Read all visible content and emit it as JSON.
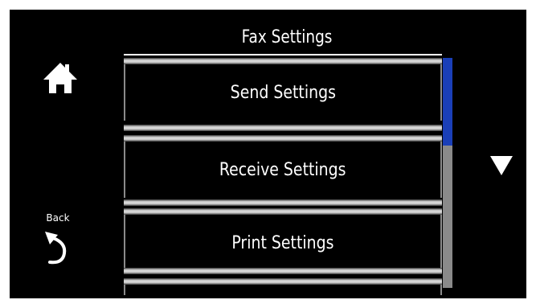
{
  "header": {
    "title": "Fax Settings"
  },
  "nav": {
    "back_label": "Back"
  },
  "menu": {
    "items": [
      {
        "label": "Send Settings"
      },
      {
        "label": "Receive Settings"
      },
      {
        "label": "Print Settings"
      }
    ]
  },
  "scroll": {
    "position_fraction": 0.0,
    "visible_fraction": 0.38
  },
  "colors": {
    "background": "#000000",
    "text": "#ffffff",
    "scrollbar_thumb": "#1a3fb8",
    "scrollbar_track": "#8a8a8a"
  },
  "icons": {
    "home": "home-icon",
    "back": "back-arrow-icon",
    "scroll_down": "triangle-down-icon"
  }
}
